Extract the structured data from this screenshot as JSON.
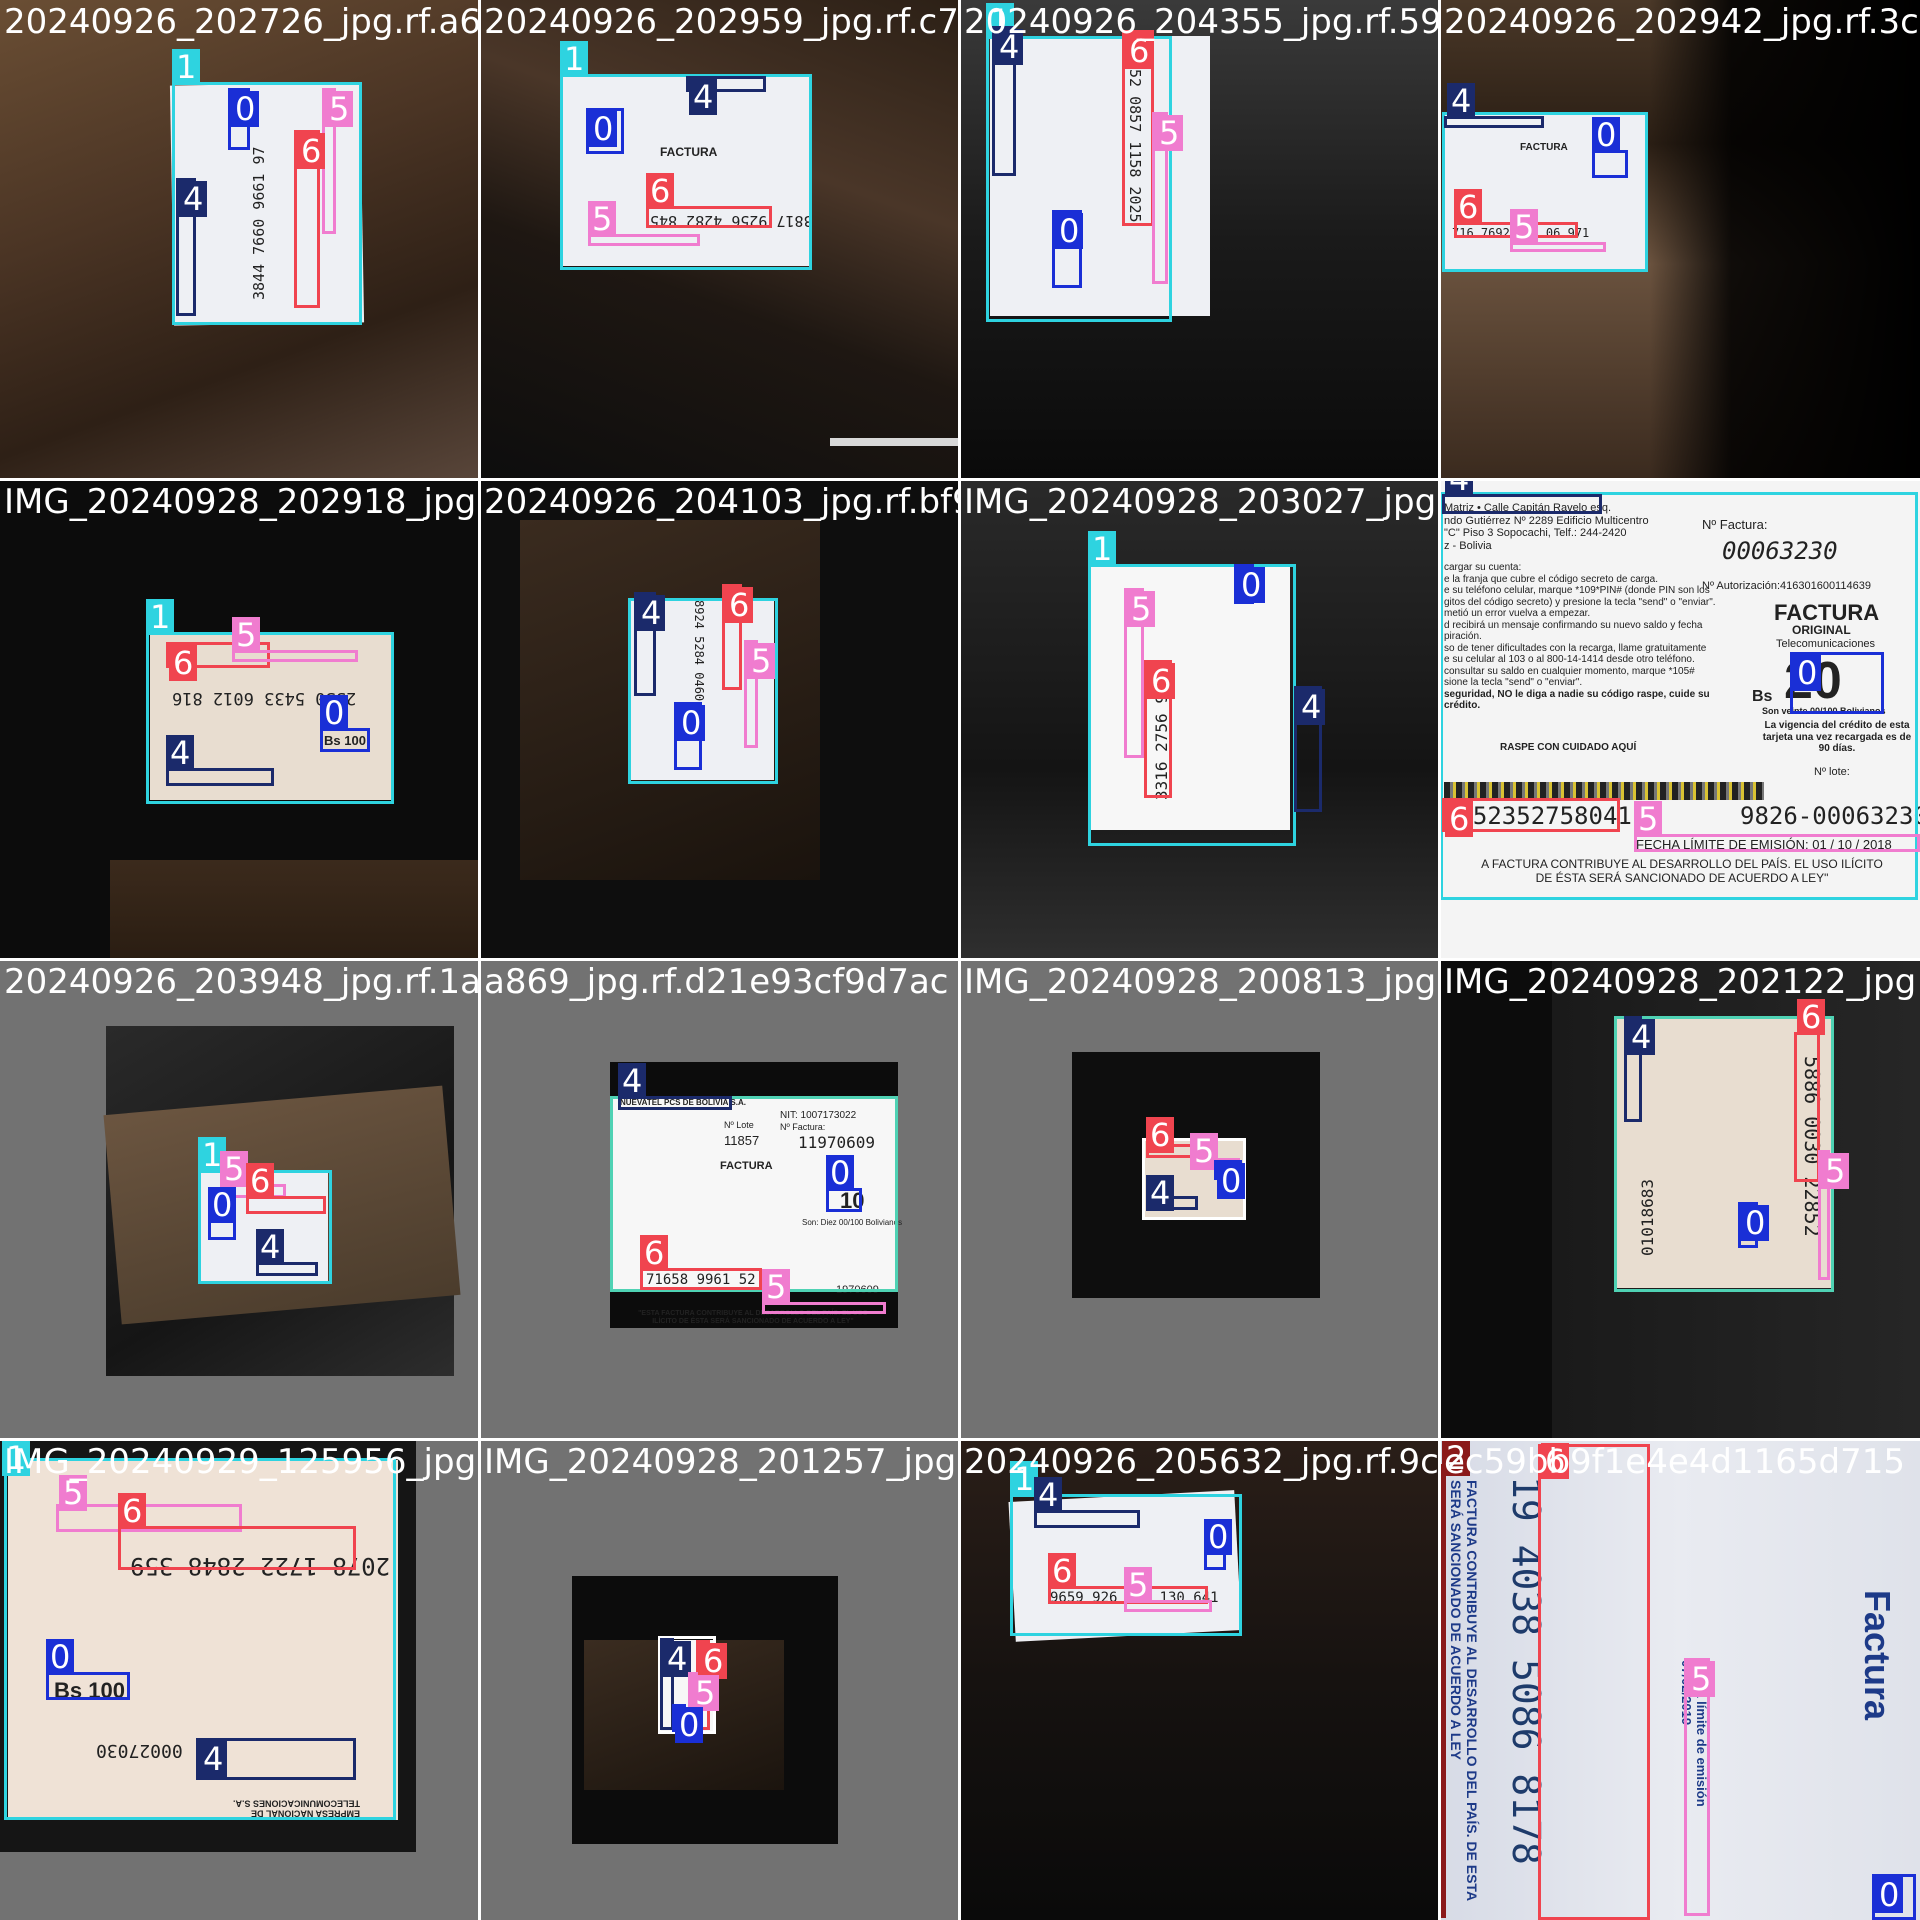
{
  "grid": {
    "tiles": [
      {
        "title": "20240926_202726_jpg.rf.a6e"
      },
      {
        "title": "20240926_202959_jpg.rf.c74"
      },
      {
        "title": "20240926_204355_jpg.rf.59"
      },
      {
        "title": "20240926_202942_jpg.rf.3c"
      },
      {
        "title": "IMG_20240928_202918_jpg"
      },
      {
        "title": "20240926_204103_jpg.rf.bf9"
      },
      {
        "title": "IMG_20240928_203027_jpg"
      },
      {
        "title": ""
      },
      {
        "title": "20240926_203948_jpg.rf.1a"
      },
      {
        "title": "a869_jpg.rf.d21e93cf9d7ac"
      },
      {
        "title": "IMG_20240928_200813_jpg"
      },
      {
        "title": "IMG_20240928_202122_jpg"
      },
      {
        "title": "IMG_20240929_125956_jpg.rf"
      },
      {
        "title": "IMG_20240928_201257_jpg"
      },
      {
        "title": "20240926_205632_jpg.rf.9c8"
      },
      {
        "title": "ec59bb9f1e4e4d1165d715"
      }
    ]
  },
  "label_names": {
    "l0": "0",
    "l1": "1",
    "l2": "2",
    "l4": "4",
    "l5": "5",
    "l6": "6"
  },
  "colors": {
    "class_0": "#1a2fd6",
    "class_1": "#2ed3e0",
    "class_2": "#8b1a1a",
    "class_4": "#1b2a6b",
    "class_5": "#f07ccf",
    "class_6": "#f0444f"
  },
  "card_text": {
    "t1_serial": "3844 7660 9661 97",
    "t2_serial": "3817 9256 4282 845",
    "t2_factura": "FACTURA",
    "t3_serial": "152 0857 1158 2025",
    "t4_serial": "716 7692 ... 06 971",
    "t4_factura": "FACTURA",
    "t5_serial": "2530 5433 6012 816",
    "t5_bs": "Bs 100",
    "t6_serial": "8924 5284 0460 5846",
    "t7_serial": "3316 2756 9565",
    "t8_line1": "Matriz • Calle Capitán Ravelo esq.",
    "t8_line2": "ndo Gutiérrez Nº 2289 Edificio Multicentro",
    "t8_line3": "\"C\" Piso 3 Sopocachi, Telf.: 244-2420",
    "t8_line4": "z - Bolivia",
    "t8_nfactura_label": "Nº Factura:",
    "t8_nfactura": "00063230",
    "t8_autorizacion": "Nº Autorización:416301600114639",
    "t8_factura": "FACTURA",
    "t8_original": "ORIGINAL",
    "t8_telecom": "Telecomunicaciones",
    "t8_bs": "Bs",
    "t8_amount": "20",
    "t8_son": "Son veinte 00/100 Bolivianos",
    "t8_vigencia": "La vigencia del crédito de esta tarjeta una vez recargada es de 90 días.",
    "t8_lote": "Nº lote:",
    "t8_instr1": "cargar su cuenta:",
    "t8_instr2": "e la franja que cubre el código secreto de carga.",
    "t8_instr3": "e su teléfono celular, marque *109*PIN# (donde PIN son los",
    "t8_instr4": "gitos del código secreto) y presione la tecla \"send\" o \"enviar\".",
    "t8_instr5": "metió un error vuelva a empezar.",
    "t8_instr6": "d recibirá un mensaje confirmando su nuevo saldo y fecha",
    "t8_instr7": "piración.",
    "t8_instr8": "so de tener dificultades con la recarga, llame gratuitamente",
    "t8_instr9": "e su celular al 103 o al 800-14-1414 desde otro teléfono.",
    "t8_instr10": "consultar su saldo en cualquier momento, marque *105#",
    "t8_instr11": "sione la tecla \"send\" o \"enviar\".",
    "t8_instr12": "seguridad, NO le diga a nadie su código raspe, cuide su crédito.",
    "t8_raspe": "RASPE CON CUIDADO AQUÍ",
    "t8_serial": "0852352758041",
    "t8_serial_right": "9826-00063230",
    "t8_fecha": "FECHA LÍMITE DE EMISIÓN: 01 / 10 / 2018",
    "t8_footer1": "A FACTURA CONTRIBUYE AL DESARROLLO DEL PAÍS. EL USO ILÍCITO",
    "t8_footer2": "DE ÉSTA SERÁ SANCIONADO DE ACUERDO A LEY\"",
    "t10_company": "NUEVATEL PCS DE BOLIVIA S.A.",
    "t10_nit": "NIT: 1007173022",
    "t10_nfactura": "Nº Factura:",
    "t10_factura_num": "11970609",
    "t10_nlote": "Nº Lote",
    "t10_lote": "11857",
    "t10_factura": "FACTURA",
    "t10_amount": "10",
    "t10_son": "Son: Diez 00/100 Bolivianos",
    "t10_serial": "71658 9961 52",
    "t10_serie": "1970609",
    "t10_footer1": "\"ESTA FACTURA CONTRIBUYE AL DESARROLLO DEL PAÍS. EL USO",
    "t10_footer2": "ILÍCITO DE ÉSTA SERÁ SANCIONADO DE ACUERDO A LEY\"",
    "t12_serial": "5886 0030 22852",
    "t12_serial2": "01018683",
    "t13_serial": "2078 1722 2848 359",
    "t13_bs": "Bs 100",
    "t13_num": "00027030",
    "t13_company": "EMPRESA NACIONAL DE TELECOMUNICACIONES S.A.",
    "t15_serial": "9659 926 ... 130 641",
    "t16_serial": "19 4038 5086 8178",
    "t16_factura": "Factura",
    "t16_fecha": "Fecha límite de emisión 07/02/2019",
    "t16_ley": "FACTURA CONTRIBUYE AL DESARROLLO DEL PAÍS. DE ESTA SERÁ SANCIONADO DE ACUERDO A LEY"
  }
}
